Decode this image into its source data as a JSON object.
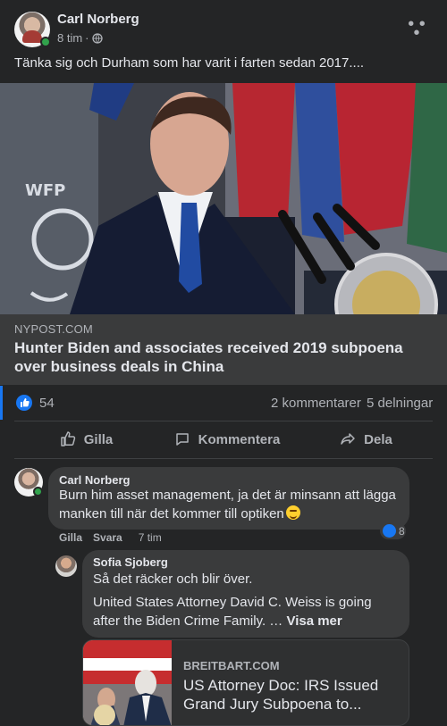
{
  "post": {
    "author": "Carl Norberg",
    "time": "8 tim",
    "separator": "·",
    "privacy_icon": "globe-icon",
    "more_icon": "more-horizontal-icon",
    "text": "Tänka sig och Durham som har varit i farten sedan 2017...."
  },
  "link_preview": {
    "domain": "NYPOST.COM",
    "title": "Hunter Biden and associates received 2019 subpoena over business deals in China"
  },
  "reactions": {
    "like_count": "54",
    "comments": "2 kommentarer",
    "shares": "5 delningar"
  },
  "actions": {
    "like": "Gilla",
    "comment": "Kommentera",
    "share": "Dela"
  },
  "comments": [
    {
      "author": "Carl Norberg",
      "text": "Burn him asset management, ja det är minsann att lägga manken till när det kommer till optiken",
      "like_label": "Gilla",
      "reply_label": "Svara",
      "time": "7 tim",
      "reaction_count": "8"
    },
    {
      "author": "Sofia Sjoberg",
      "text_line1": "Så det räcker och blir över.",
      "text_line2": "United States Attorney David C. Weiss is going after the Biden Crime Family. …",
      "see_more": "Visa mer",
      "shared_link": {
        "domain": "BREITBART.COM",
        "title": "US Attorney Doc: IRS Issued Grand Jury Subpoena to..."
      }
    }
  ],
  "colors": {
    "background": "#242526",
    "surface": "#3a3b3c",
    "text": "#e4e6eb",
    "muted": "#b0b3b8",
    "accent": "#1877f2",
    "online": "#31a24c"
  }
}
